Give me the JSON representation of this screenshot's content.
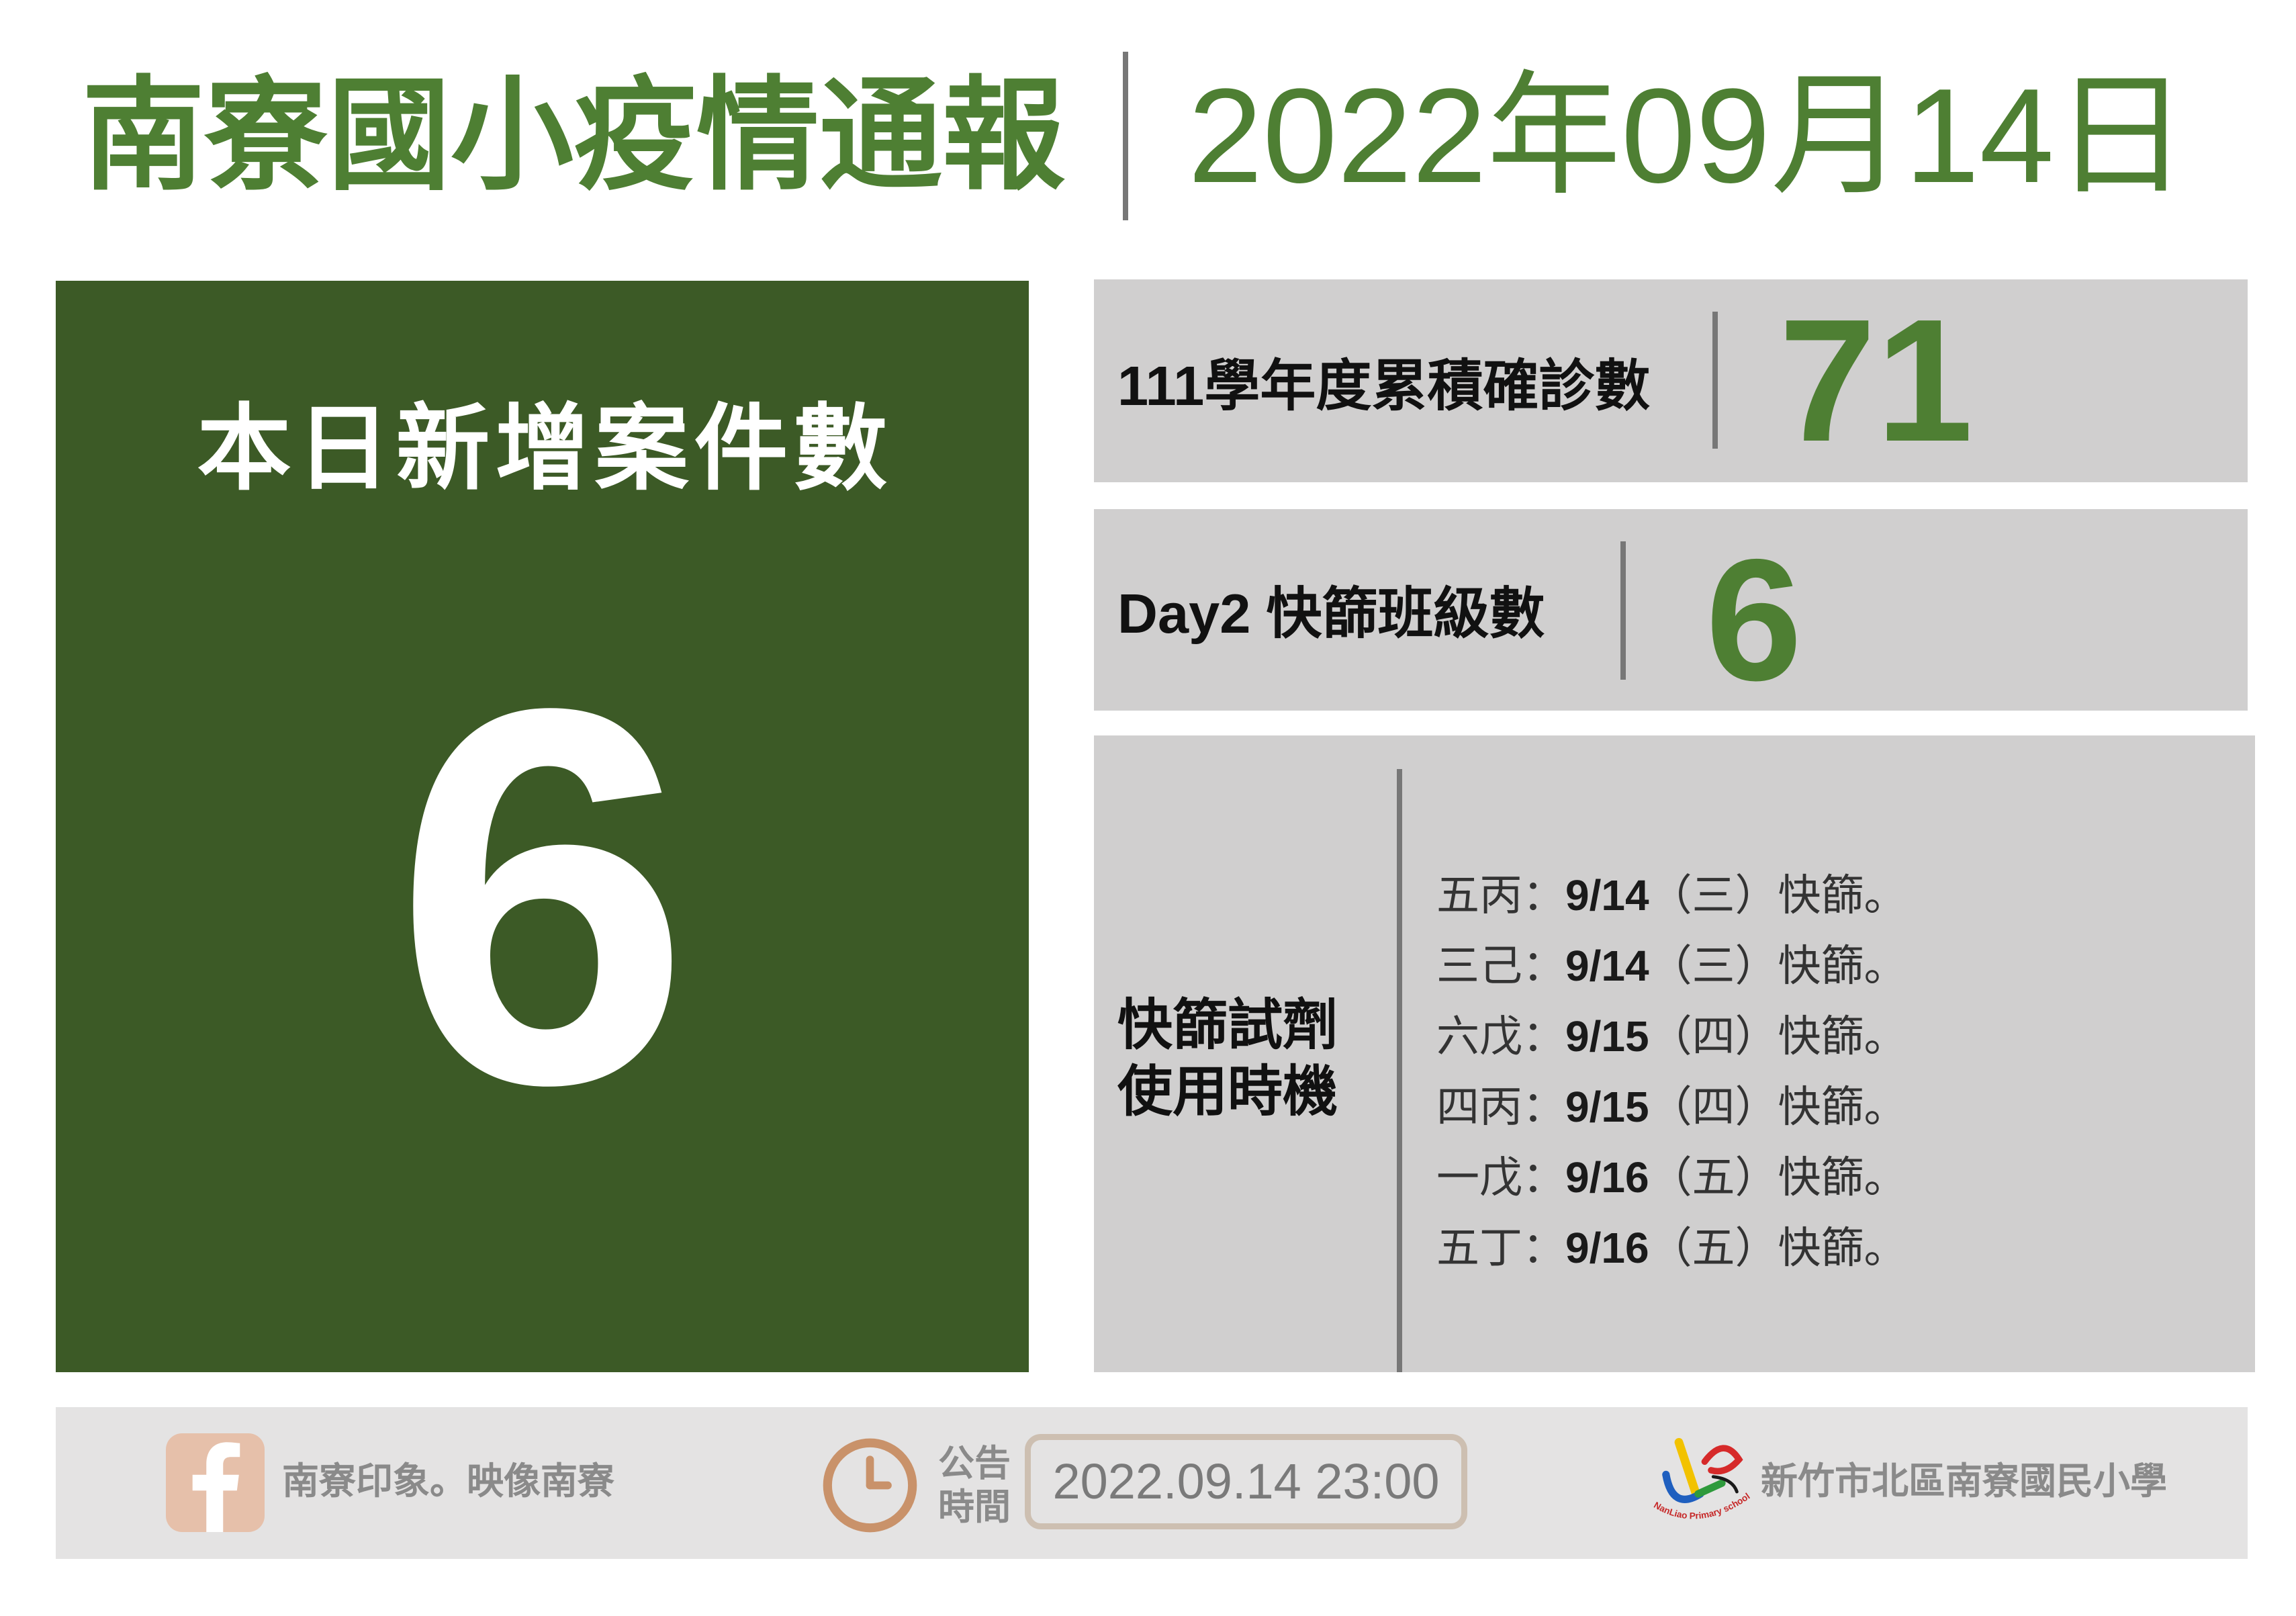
{
  "header": {
    "title": "南寮國小疫情通報",
    "date": "2022年09月14日"
  },
  "today": {
    "label": "本日新增案件數",
    "value": "6"
  },
  "stats": [
    {
      "label": "111學年度累積確診數",
      "value": "71"
    },
    {
      "label": "Day2 快篩班級數",
      "value": "6"
    }
  ],
  "screening": {
    "label_lines": [
      "快篩試劑",
      "使用時機"
    ],
    "items": [
      {
        "prefix": "五丙：",
        "date": "9/14",
        "suffix": "（三）快篩。"
      },
      {
        "prefix": "三己：",
        "date": "9/14",
        "suffix": "（三）快篩。"
      },
      {
        "prefix": "六戊：",
        "date": "9/15",
        "suffix": "（四）快篩。"
      },
      {
        "prefix": "四丙：",
        "date": "9/15",
        "suffix": "（四）快篩。"
      },
      {
        "prefix": "一戊：",
        "date": "9/16",
        "suffix": "（五）快篩。"
      },
      {
        "prefix": "五丁：",
        "date": "9/16",
        "suffix": "（五）快篩。"
      }
    ]
  },
  "footer": {
    "facebook": {
      "icon": "facebook-icon",
      "page_name": "南寮印象。映像南寮"
    },
    "announcement": {
      "icon": "clock-icon",
      "label_lines": [
        "公告",
        "時間"
      ],
      "time": "2022.09.14 23:00"
    },
    "school": {
      "logo": "school-logo",
      "logo_lettering": "NanLiao Primary school",
      "name": "新竹市北區南寮國民小學"
    }
  },
  "colors": {
    "green": "#4e7f33",
    "dark": "#3c5a26",
    "panel": "#d0cfcf",
    "footer": "#e4e3e3",
    "peach": "#e6c0aa",
    "clock": "#c9926a",
    "muted": "#8a8a8a"
  }
}
